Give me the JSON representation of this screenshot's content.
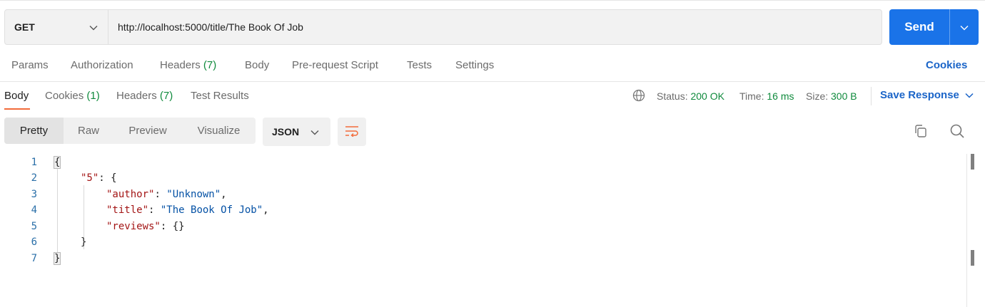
{
  "request": {
    "method": "GET",
    "url": "http://localhost:5000/title/The Book Of Job",
    "send_label": "Send"
  },
  "request_tabs": [
    {
      "label": "Params",
      "count": ""
    },
    {
      "label": "Authorization",
      "count": ""
    },
    {
      "label": "Headers",
      "count": "(7)"
    },
    {
      "label": "Body",
      "count": ""
    },
    {
      "label": "Pre-request Script",
      "count": ""
    },
    {
      "label": "Tests",
      "count": ""
    },
    {
      "label": "Settings",
      "count": ""
    }
  ],
  "cookies_link": "Cookies",
  "response_tabs": [
    {
      "label": "Body",
      "count": ""
    },
    {
      "label": "Cookies",
      "count": "(1)"
    },
    {
      "label": "Headers",
      "count": "(7)"
    },
    {
      "label": "Test Results",
      "count": ""
    }
  ],
  "response_status": {
    "status_label": "Status:",
    "status_value": "200 OK",
    "time_label": "Time:",
    "time_value": "16 ms",
    "size_label": "Size:",
    "size_value": "300 B"
  },
  "save_response": "Save Response",
  "view_modes": [
    "Pretty",
    "Raw",
    "Preview",
    "Visualize"
  ],
  "format": "JSON",
  "code_lines": [
    {
      "num": "1"
    },
    {
      "num": "2",
      "key": "\"5\""
    },
    {
      "num": "3",
      "key": "\"author\"",
      "value": "\"Unknown\""
    },
    {
      "num": "4",
      "key": "\"title\"",
      "value": "\"The Book Of Job\""
    },
    {
      "num": "5",
      "key": "\"reviews\""
    },
    {
      "num": "6"
    },
    {
      "num": "7"
    }
  ],
  "colors": {
    "accent": "#1a73e8",
    "status_green": "#0f8a3c",
    "active_tab_underline": "#f26b3a",
    "json_key": "#a31515",
    "json_string": "#0451a5"
  },
  "icons": {
    "method_dropdown": "chevron-down-icon",
    "send_dropdown": "chevron-down-icon",
    "globe": "globe-icon",
    "save_dropdown": "chevron-down-icon",
    "format_dropdown": "chevron-down-icon",
    "wrap": "wrap-lines-icon",
    "copy": "copy-icon",
    "search": "search-icon"
  }
}
